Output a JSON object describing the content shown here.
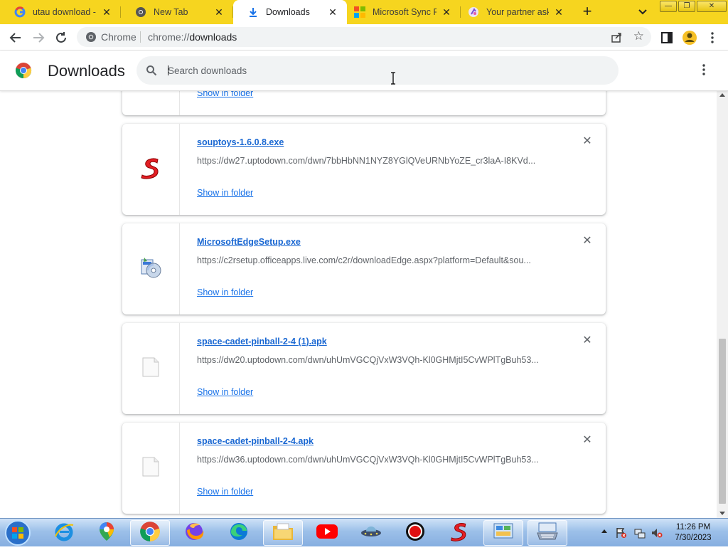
{
  "tabs": [
    {
      "title": "utau download - G",
      "icon": "google-icon",
      "active": false
    },
    {
      "title": "New Tab",
      "icon": "chrome-tab-icon",
      "active": false
    },
    {
      "title": "Downloads",
      "icon": "download-icon",
      "active": true
    },
    {
      "title": "Microsoft Sync Fr",
      "icon": "microsoft-logo-icon",
      "active": false
    },
    {
      "title": "Your partner asks",
      "icon": "partner-icon",
      "active": false
    }
  ],
  "tab_close_glyph": "✕",
  "new_tab_glyph": "+",
  "omnibox": {
    "site_label": "Chrome",
    "url_scheme": "chrome://",
    "url_host": "downloads"
  },
  "page": {
    "title": "Downloads"
  },
  "search": {
    "placeholder": "Search downloads",
    "value": ""
  },
  "downloads": [
    {
      "name": "",
      "url": "",
      "action": "Show in folder",
      "icon": "generic-file-icon"
    },
    {
      "name": "souptoys-1.6.0.8.exe",
      "url": "https://dw27.uptodown.com/dwn/7bbHbNN1NYZ8YGlQVeURNbYoZE_cr3laA-I8KVd...",
      "action": "Show in folder",
      "icon": "souptoys-icon"
    },
    {
      "name": "MicrosoftEdgeSetup.exe",
      "url": "https://c2rsetup.officeapps.live.com/c2r/downloadEdge.aspx?platform=Default&sou...",
      "action": "Show in folder",
      "icon": "installer-icon"
    },
    {
      "name": "space-cadet-pinball-2-4 (1).apk",
      "url": "https://dw20.uptodown.com/dwn/uhUmVGCQjVxW3VQh-Kl0GHMjtI5CvWPlTgBuh53...",
      "action": "Show in folder",
      "icon": "generic-file-icon"
    },
    {
      "name": "space-cadet-pinball-2-4.apk",
      "url": "https://dw36.uptodown.com/dwn/uhUmVGCQjVxW3VQh-Kl0GHMjtI5CvWPlTgBuh53...",
      "action": "Show in folder",
      "icon": "generic-file-icon"
    }
  ],
  "remove_glyph": "✕",
  "taskbar": {
    "apps": [
      "internet-explorer-icon",
      "maps-icon",
      "chrome-icon",
      "firefox-icon",
      "edge-icon",
      "file-explorer-icon",
      "youtube-icon",
      "ufo-icon",
      "record-icon",
      "souptoys-icon",
      "control-panel-icon",
      "keyboard-app-icon"
    ],
    "clock_time": "11:26 PM",
    "clock_date": "7/30/2023"
  },
  "colors": {
    "tabstrip": "#f6d51f",
    "link": "#1a73e8",
    "card_border": "#e6e6e6"
  }
}
